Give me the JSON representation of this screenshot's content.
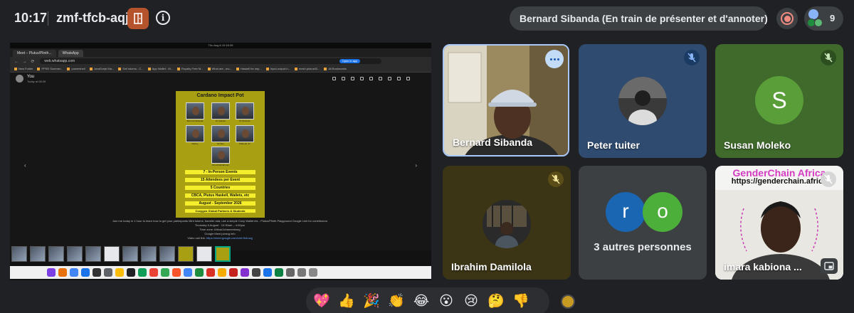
{
  "header": {
    "time": "10:17",
    "meeting_code": "zmf-tfcb-aqj",
    "presenter_label": "Bernard Sibanda (En train de présenter et d'annoter)",
    "participant_count": "9"
  },
  "shared_screen": {
    "os_clock": "Thu Aug 6  10:16:35",
    "tabs": [
      "Meet – Plutus/Plinth...",
      "WhatsApp"
    ],
    "url": "web.whatsapp.com",
    "open_in_app": "Open in app",
    "bookmarks": [
      "New Folder",
      "PPSE Summer...",
      "powershell",
      "JavaScript Ma...",
      "Sell tokens - C...",
      "App Wallet - M...",
      "Royalty Free M...",
      "What are...mo...",
      "Haskell for imp...",
      "Input-output-h...",
      "mesh.plutus/t2...",
      "All Bookmarks"
    ],
    "sender": "You",
    "sent_time": "Today at 08:39",
    "poster": {
      "title": "Cardano Impact Pot",
      "captions": [
        "Bernard Sibanda",
        "Dr Gabriel",
        "Dr Rutendo",
        "Marley",
        "Mr Ben",
        "Olabode Jnr"
      ],
      "center_caption": "Hiro Abdulrahman",
      "lines": [
        "7 - In-Person Events",
        "15 Attendees per Event",
        "5 Countries",
        "CBCA, Plutus Haskell, Wallets, etc",
        "August - September 2026",
        "Coxygen Global Partners & Students"
      ]
    },
    "description_lines": [
      "Join me today in 1 hour to learn how to get your participants Mint tokens, transfer ada, use a simple Coxy Wallet etc - Plutus/Plinth Playground Google Link for contributors",
      "Thursday 6 August · 10:30am – 4:00pm",
      "Time zone: Africa/Johannesburg",
      "Google Meet joining info"
    ],
    "video_link_label": "Video call link: ",
    "video_link": "https://meet.google.com/zmf-tfcb-aqj"
  },
  "participants": {
    "bernard": "Bernard Sibanda",
    "peter": "Peter tuiter",
    "susan": "Susan Moleko",
    "susan_initial": "S",
    "ibrahim": "Ibrahim Damilola",
    "others_initials": [
      "r",
      "o"
    ],
    "others_label": "3 autres personnes",
    "imara": "imara kabiona ...",
    "imara_title": "GenderChain Africa",
    "imara_url": "https://genderchain.africa"
  },
  "reactions": [
    "💖",
    "👍",
    "🎉",
    "👏",
    "😂",
    "😮",
    "😢",
    "🤔",
    "👎"
  ],
  "colors": {
    "background": "#202124",
    "pill": "#3c4043",
    "accent_border": "#a8c7fa",
    "record": "#f28b82",
    "door": "#b5532d",
    "poster": "#a8a012"
  }
}
